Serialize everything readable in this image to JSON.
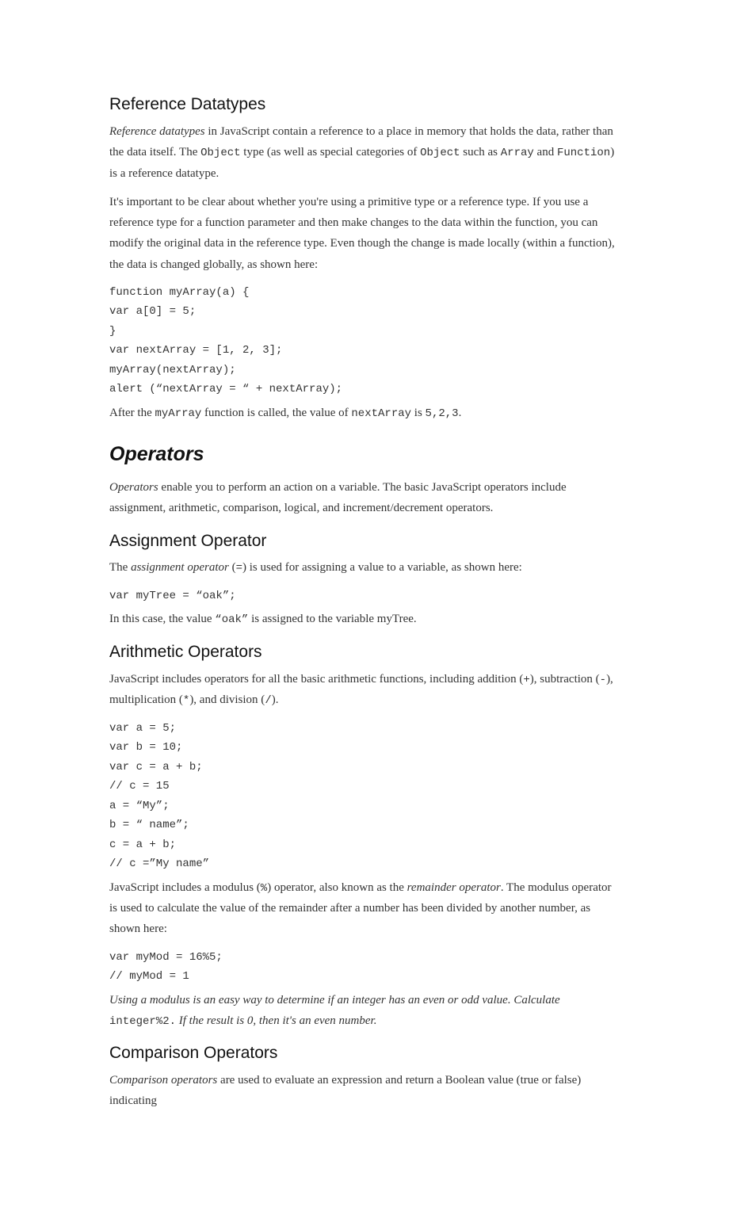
{
  "sections": {
    "refDatatypes": {
      "heading": "Reference Datatypes",
      "p1_i1": "Reference datatypes",
      "p1_t1": " in JavaScript contain a reference to a place in memory that holds the data, rather than the data itself. The ",
      "p1_c1": "Object",
      "p1_t2": " type (as well as special categories of ",
      "p1_c2": "Object",
      "p1_t3": " such as ",
      "p1_c3": "Array",
      "p1_t4": " and ",
      "p1_c4": "Function",
      "p1_t5": ") is a reference datatype.",
      "p2": "It's important to be clear about whether you're using a primitive type or a reference type. If you use a reference type for a function parameter and then make changes to the data within the function, you can modify the original data in the reference type. Even though the change is made locally (within a function), the data is changed globally, as shown here:",
      "code1": "function myArray(a) {\nvar a[0] = 5;\n}\nvar nextArray = [1, 2, 3];\nmyArray(nextArray);\nalert (“nextArray = “ + nextArray);",
      "p3_t1": "After the ",
      "p3_c1": "myArray",
      "p3_t2": " function is called, the value of ",
      "p3_c2": "nextArray",
      "p3_t3": " is ",
      "p3_c3": "5,2,3",
      "p3_t4": "."
    },
    "operators": {
      "heading": "Operators",
      "p1_i1": "Operators",
      "p1_t1": " enable you to perform an action on a variable. The basic JavaScript operators include assignment, arithmetic, comparison, logical, and increment/decrement operators."
    },
    "assignment": {
      "heading": "Assignment Operator",
      "p1_t1": "The ",
      "p1_i1": "assignment operator",
      "p1_t2": " (",
      "p1_c1": "=",
      "p1_t3": ") is used for assigning a value to a variable, as shown here:",
      "code1": "var myTree = “oak”;",
      "p2_t1": "In this case, the value ",
      "p2_c1": "“oak”",
      "p2_t2": " is assigned to the variable myTree."
    },
    "arithmetic": {
      "heading": "Arithmetic Operators",
      "p1_t1": "JavaScript includes operators for all the basic arithmetic functions, including addition (",
      "p1_c1": "+",
      "p1_t2": "), subtraction (",
      "p1_c2": "-",
      "p1_t3": "), multiplication (",
      "p1_c3": "*",
      "p1_t4": "), and division (",
      "p1_c4": "/",
      "p1_t5": ").",
      "code1": "var a = 5;\nvar b = 10;\nvar c = a + b;\n// c = 15\na = “My”;\nb = “ name”;\nc = a + b;\n// c =”My name”",
      "p2_t1": "JavaScript includes a modulus (",
      "p2_c1": "%",
      "p2_t2": ") operator, also known as the ",
      "p2_i1": "remainder operator",
      "p2_t3": ". The modulus operator is used to calculate the value of the remainder after a number has been divided by another number, as shown here:",
      "code2": "var myMod = 16%5;\n// myMod = 1",
      "note_i1": "Using a modulus is an easy way to determine if an integer has an even or odd value. Calculate ",
      "note_c1": "integer%2.",
      "note_i2": " If the result is 0, then it's an even number."
    },
    "comparison": {
      "heading": "Comparison Operators",
      "p1_i1": "Comparison operators",
      "p1_t1": " are used to evaluate an expression and return a Boolean value (true or false) indicating"
    }
  }
}
